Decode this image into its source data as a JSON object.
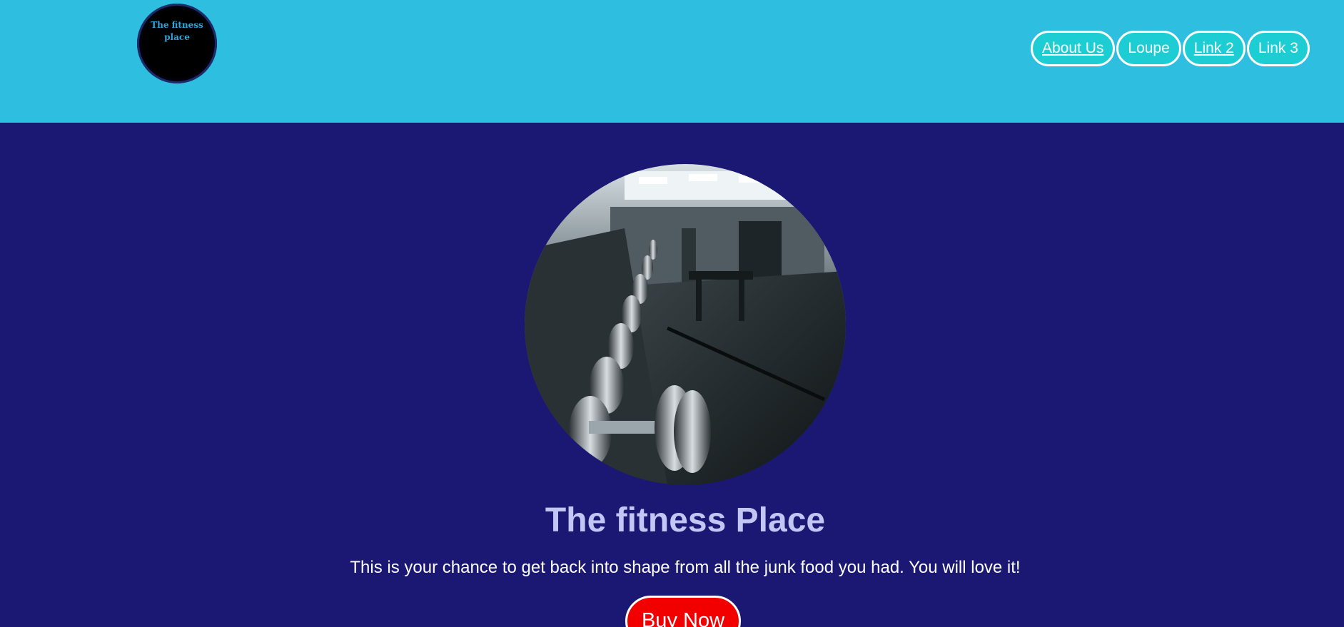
{
  "header": {
    "logo_text": "The fitness place",
    "nav": [
      {
        "label": "About Us"
      },
      {
        "label": "Loupe"
      },
      {
        "label": "Link 2"
      },
      {
        "label": "Link 3"
      }
    ]
  },
  "hero": {
    "image_icon": "gym-dumbbells-photo",
    "title": "The fitness Place",
    "description": "This is your chance to get back into shape from all the junk food you had. You will love it!",
    "cta_label": "Buy Now"
  },
  "colors": {
    "header_bg": "#2dbee0",
    "main_bg": "#1b1874",
    "nav_bg": "#1ccdd3",
    "title": "#c2c6f4",
    "cta_bg": "#f20000"
  }
}
